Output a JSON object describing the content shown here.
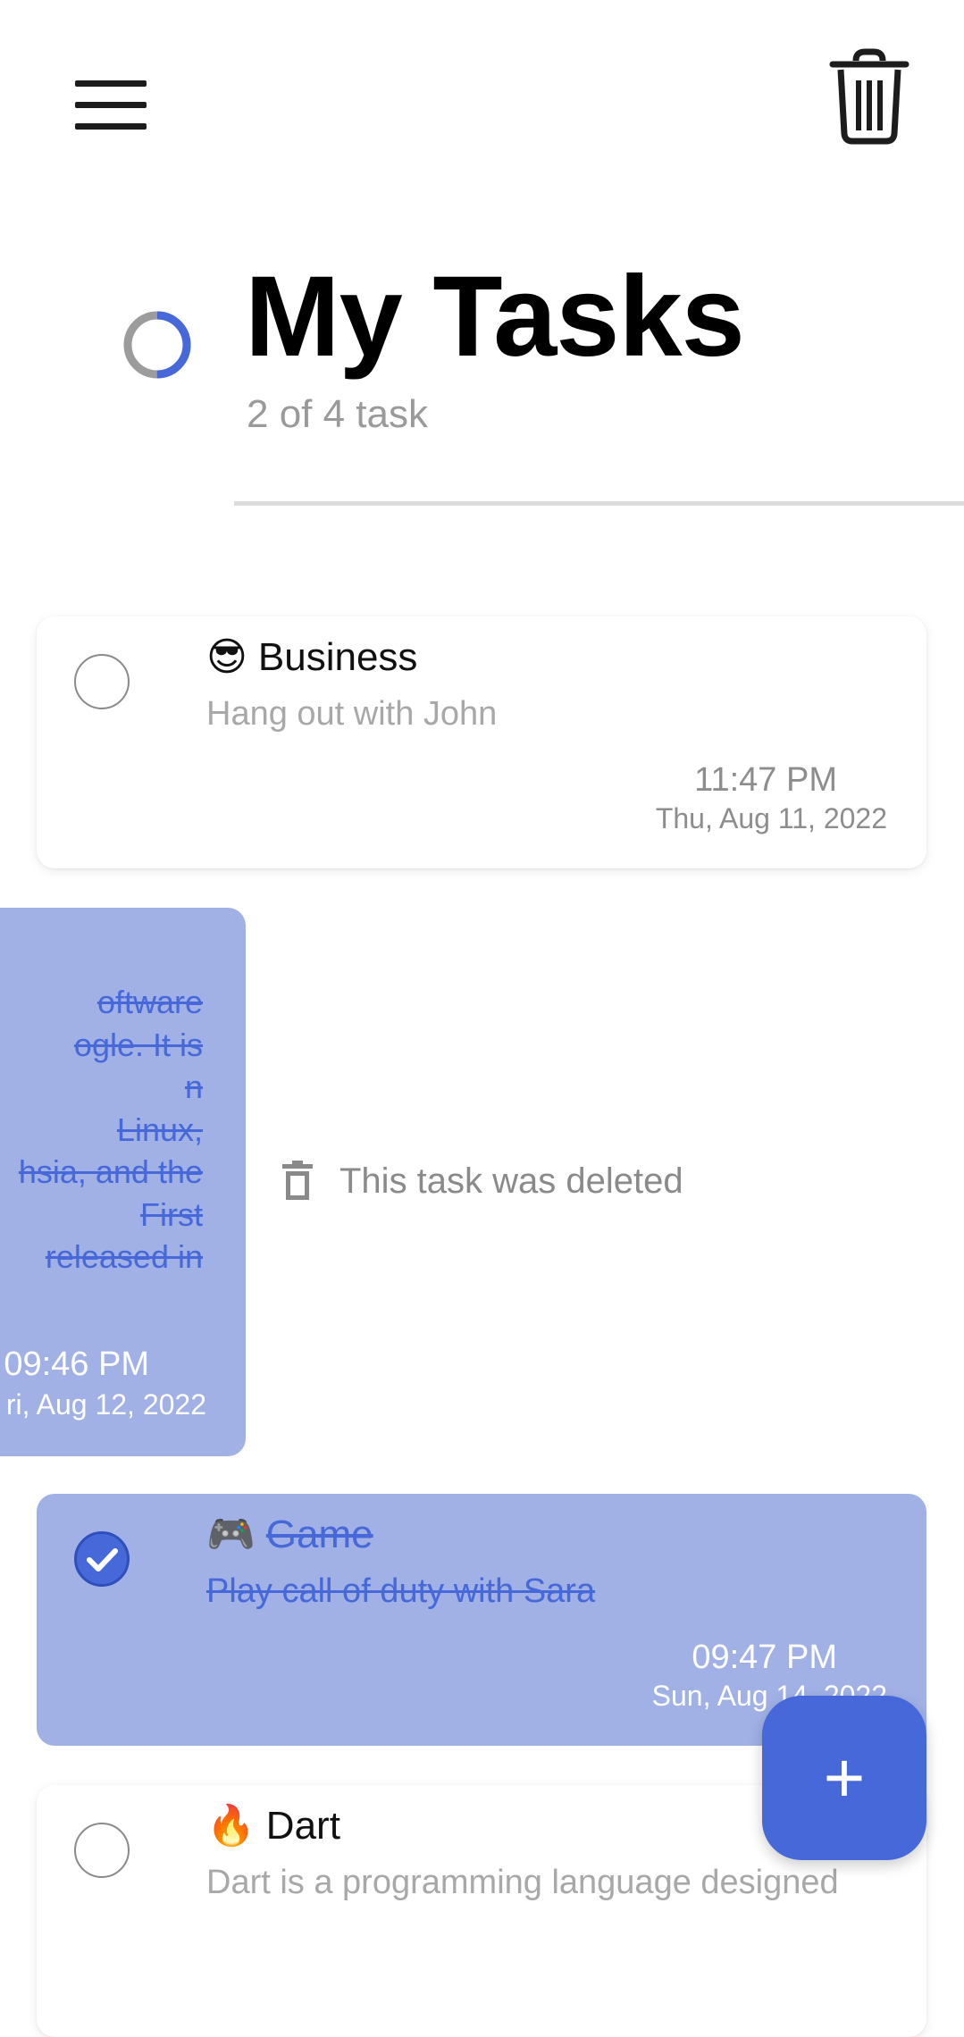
{
  "header": {
    "title": "My Tasks",
    "task_count": "2 of 4 task",
    "progress_fraction": 0.5
  },
  "toolbar": {
    "menu_icon": "hamburger-menu-icon",
    "delete_all_icon": "trash-icon"
  },
  "tasks": [
    {
      "emoji": "😎",
      "title": "Business",
      "description": "Hang out with John",
      "time": "11:47 PM",
      "date": "Thu, Aug 11, 2022",
      "completed": false
    },
    {
      "description_lines": [
        "oftware",
        "ogle. It is",
        "n",
        "Linux,",
        "hsia, and the",
        "First",
        "released in"
      ],
      "time": "09:46 PM",
      "date": "ri, Aug 12, 2022",
      "completed": true,
      "swiped": true
    },
    {
      "emoji": "🎮",
      "title": "Game",
      "description": "Play call of duty with Sara",
      "time": "09:47 PM",
      "date": "Sun, Aug 14, 2022",
      "completed": true
    },
    {
      "emoji": "🔥",
      "title": "Dart",
      "description": "Dart is a programming language designed",
      "completed": false
    }
  ],
  "deleted_notice": "This task was deleted",
  "fab": {
    "label": "+"
  },
  "colors": {
    "accent": "#4668d9",
    "completed_card": "#a1b1e6",
    "muted_text": "#9a9a9a"
  }
}
